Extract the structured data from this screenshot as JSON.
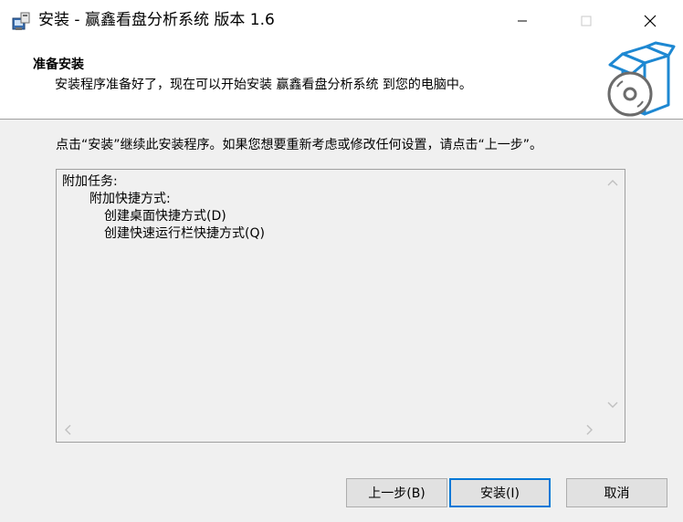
{
  "window": {
    "title": "安装 - 赢鑫看盘分析系统 版本 1.6",
    "icons": [
      "installer-app-icon",
      "minimize-icon",
      "maximize-icon",
      "close-icon"
    ]
  },
  "header": {
    "title": "准备安装",
    "subtitle": "安装程序准备好了，现在可以开始安装 赢鑫看盘分析系统 到您的电脑中。",
    "image": "setup-box-disc-icon"
  },
  "main": {
    "instruction": "点击“安装”继续此安装程序。如果您想要重新考虑或修改任何设置，请点击“上一步”。",
    "memo_lines": [
      "附加任务:",
      "附加快捷方式:",
      "创建桌面快捷方式(D)",
      "创建快速运行栏快捷方式(Q)"
    ]
  },
  "buttons": {
    "back": "上一步(B)",
    "install": "安装(I)",
    "cancel": "取消"
  },
  "colors": {
    "accent": "#0078d7",
    "panel_bg": "#f0f0f0",
    "button_bg": "#e1e1e1"
  }
}
